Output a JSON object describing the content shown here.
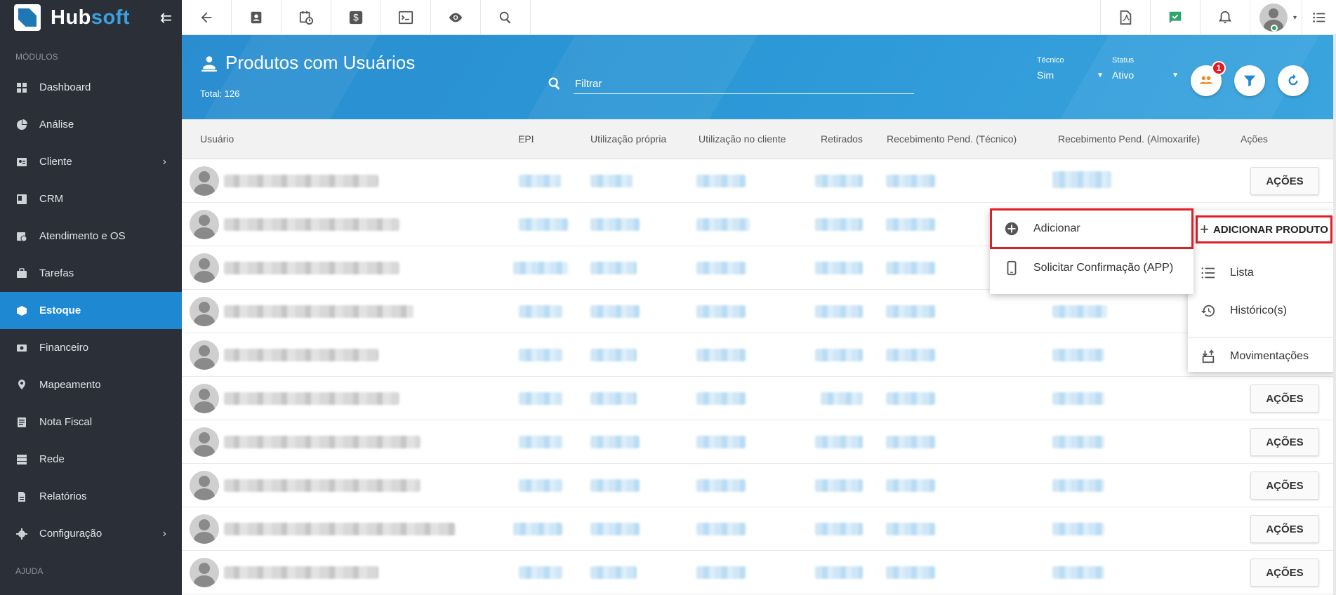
{
  "brand": {
    "name_a": "Hub",
    "name_b": "soft"
  },
  "sidebar": {
    "section_modules": "MÓDULOS",
    "section_help": "AJUDA",
    "items": [
      {
        "label": "Dashboard",
        "icon": "grid-icon"
      },
      {
        "label": "Análise",
        "icon": "pie-icon"
      },
      {
        "label": "Cliente",
        "icon": "contact-icon",
        "has_submenu": true
      },
      {
        "label": "CRM",
        "icon": "crm-icon"
      },
      {
        "label": "Atendimento e OS",
        "icon": "calendar-clock-icon"
      },
      {
        "label": "Tarefas",
        "icon": "briefcase-icon"
      },
      {
        "label": "Estoque",
        "icon": "box-icon",
        "active": true
      },
      {
        "label": "Financeiro",
        "icon": "money-icon"
      },
      {
        "label": "Mapeamento",
        "icon": "map-pin-icon"
      },
      {
        "label": "Nota Fiscal",
        "icon": "receipt-icon"
      },
      {
        "label": "Rede",
        "icon": "server-icon"
      },
      {
        "label": "Relatórios",
        "icon": "report-icon"
      },
      {
        "label": "Configuração",
        "icon": "gear-icon",
        "has_submenu": true
      }
    ]
  },
  "header": {
    "title": "Produtos com Usuários",
    "total": "Total: 126",
    "filter_placeholder": "Filtrar",
    "tecnico": {
      "label": "Técnico",
      "value": "Sim"
    },
    "status": {
      "label": "Status",
      "value": "Ativo"
    },
    "notification_count": "1"
  },
  "table": {
    "columns": [
      "Usuário",
      "EPI",
      "Utilização própria",
      "Utilização no cliente",
      "Retirados",
      "Recebimento Pend. (Técnico)",
      "Recebimento Pend. (Almoxarife)",
      "Ações"
    ],
    "action_label": "AÇÕES"
  },
  "menus": {
    "left": [
      {
        "label": "Adicionar",
        "icon": "plus-circle-icon"
      },
      {
        "label": "Solicitar Confirmação (APP)",
        "icon": "smartphone-icon"
      }
    ],
    "right": {
      "add_produto": "ADICIONAR PRODUTO",
      "items": [
        {
          "label": "Lista",
          "icon": "list-icon"
        },
        {
          "label": "Histórico(s)",
          "icon": "history-icon"
        },
        {
          "label": "Movimentações",
          "icon": "movements-icon"
        }
      ]
    }
  },
  "colors": {
    "sidebar_bg": "#2b3038",
    "accent": "#1e88d2",
    "highlight": "#e01e26",
    "badge": "#e8191f"
  }
}
